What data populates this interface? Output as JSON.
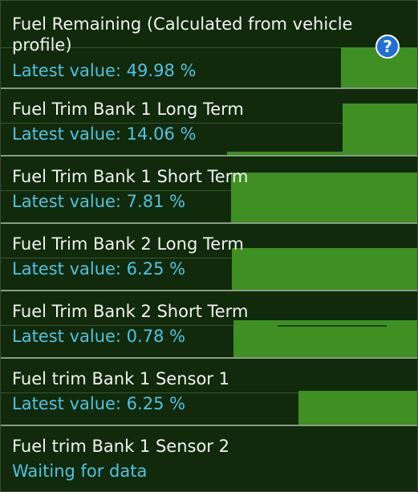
{
  "sensors": [
    {
      "name": "Fuel Remaining (Calculated from vehicle profile)",
      "value": "Latest value: 49.98 %",
      "help_icon": "?"
    },
    {
      "name": "Fuel Trim Bank 1 Long Term",
      "value": "Latest value: 14.06 %"
    },
    {
      "name": "Fuel Trim Bank 1 Short Term",
      "value": "Latest value: 7.81 %"
    },
    {
      "name": "Fuel Trim Bank 2 Long Term",
      "value": "Latest value: 6.25 %"
    },
    {
      "name": "Fuel Trim Bank 2 Short Term",
      "value": "Latest value: 0.78 %"
    },
    {
      "name": "Fuel trim Bank 1 Sensor 1",
      "value": "Latest value: 6.25 %"
    },
    {
      "name": "Fuel trim Bank 1 Sensor 2",
      "value": "Waiting for data"
    }
  ],
  "colors": {
    "background": "#112a0b",
    "graph_fill": "#3f8f23",
    "title_text": "#f2f2f2",
    "value_text": "#4fc3e6",
    "divider": "#8a9a86",
    "help_icon": "#1e6fd6"
  }
}
